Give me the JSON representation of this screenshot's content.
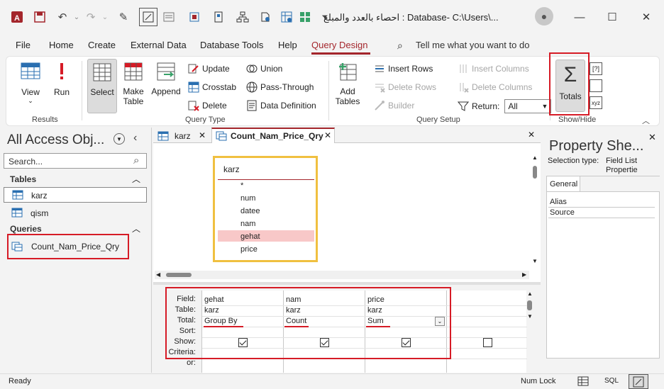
{
  "window": {
    "title": "احصاء بالعدد والمبلغ : Database- C:\\Users\\...",
    "controls": [
      "minimize",
      "maximize",
      "close"
    ]
  },
  "menu": {
    "items": [
      "File",
      "Home",
      "Create",
      "External Data",
      "Database Tools",
      "Help",
      "Query Design"
    ],
    "active": "Query Design",
    "tell_me": "Tell me what you want to do"
  },
  "ribbon": {
    "results": {
      "label": "Results",
      "view": "View",
      "run": "Run"
    },
    "query_type": {
      "label": "Query Type",
      "select": "Select",
      "make_table": "Make Table",
      "append": "Append",
      "update": "Update",
      "crosstab": "Crosstab",
      "delete": "Delete",
      "union": "Union",
      "pass_through": "Pass-Through",
      "data_definition": "Data Definition"
    },
    "query_setup": {
      "label": "Query Setup",
      "add_tables": "Add Tables",
      "insert_rows": "Insert Rows",
      "delete_rows": "Delete Rows",
      "builder": "Builder",
      "insert_columns": "Insert Columns",
      "delete_columns": "Delete Columns",
      "return_label": "Return:",
      "return_value": "All"
    },
    "show_hide": {
      "label": "Show/Hide",
      "totals": "Totals"
    }
  },
  "nav": {
    "title": "All Access Obj...",
    "search_placeholder": "Search...",
    "tables_header": "Tables",
    "tables": [
      "karz",
      "qism"
    ],
    "queries_header": "Queries",
    "queries": [
      "Count_Nam_Price_Qry"
    ]
  },
  "doc": {
    "tabs": [
      {
        "label": "karz",
        "active": false
      },
      {
        "label": "Count_Nam_Price_Qry",
        "active": true
      }
    ],
    "field_list": {
      "title": "karz",
      "fields": [
        "*",
        "num",
        "datee",
        "nam",
        "gehat",
        "price"
      ],
      "selected": "gehat"
    },
    "grid": {
      "row_labels": [
        "Field:",
        "Table:",
        "Total:",
        "Sort:",
        "Show:",
        "Criteria:",
        "or:"
      ],
      "columns": [
        {
          "field": "gehat",
          "table": "karz",
          "total": "Group By",
          "show": true
        },
        {
          "field": "nam",
          "table": "karz",
          "total": "Count",
          "show": true
        },
        {
          "field": "price",
          "table": "karz",
          "total": "Sum",
          "show": true
        },
        {
          "field": "",
          "table": "",
          "total": "",
          "show": false
        }
      ]
    }
  },
  "property_sheet": {
    "title": "Property She...",
    "selection_type_label": "Selection type:",
    "selection_type_value": "Field List Propertie",
    "tab": "General",
    "properties": [
      "Alias",
      "Source"
    ]
  },
  "status": {
    "left": "Ready",
    "num_lock": "Num Lock",
    "sql": "SQL"
  },
  "colors": {
    "accent": "#a4262c",
    "highlight_red": "#d61b26",
    "selected_field": "#f8c8c8",
    "field_list_border": "#f0c040"
  }
}
